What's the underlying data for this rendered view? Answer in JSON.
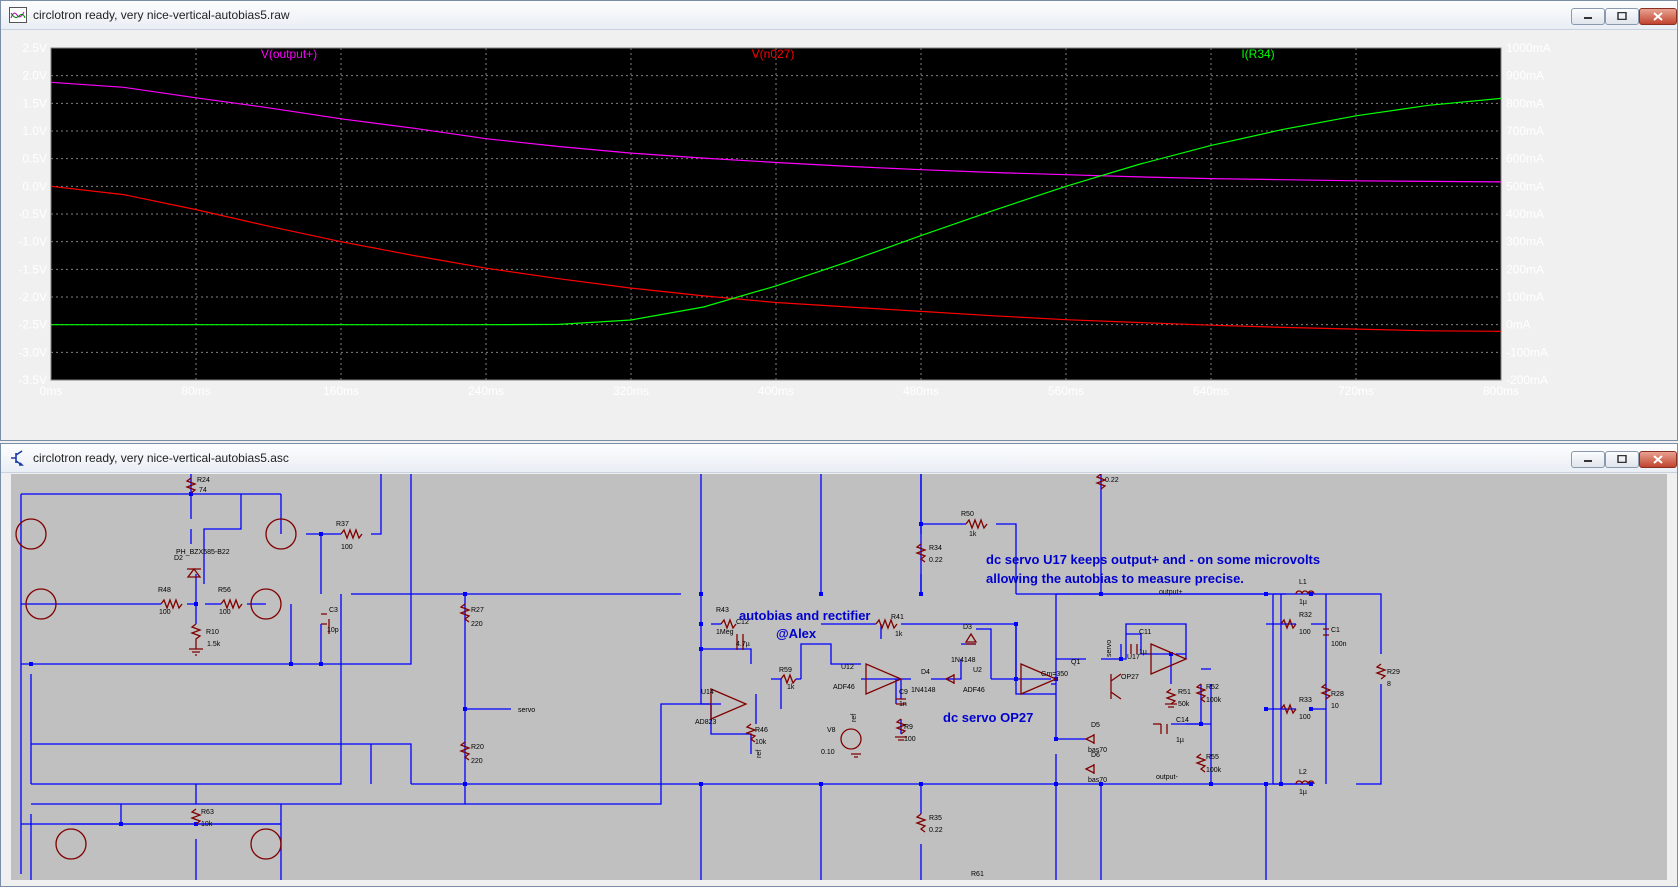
{
  "waveform_window": {
    "title": "circlotron ready, very nice-vertical-autobias5.raw",
    "icon": "waveform-icon",
    "buttons": {
      "minimize": "minimize-icon",
      "maximize": "maximize-icon",
      "close": "close-icon"
    }
  },
  "schematic_window": {
    "title": "circlotron ready, very nice-vertical-autobias5.asc",
    "icon": "schematic-icon",
    "buttons": {
      "minimize": "minimize-icon",
      "maximize": "maximize-icon",
      "close": "close-icon"
    }
  },
  "colors": {
    "plot_bg": "#000000",
    "axis_text": "#ffffff",
    "grid": "#808080",
    "schematic_bg": "#c0c0c0",
    "wire": "#0000ff",
    "component": "#800000",
    "annotation": "#0000cc"
  },
  "chart_data": {
    "type": "line",
    "x": [
      0,
      40,
      80,
      120,
      160,
      200,
      240,
      280,
      320,
      360,
      400,
      440,
      480,
      520,
      560,
      600,
      640,
      680,
      720,
      760,
      800
    ],
    "x_ticks": [
      "0ms",
      "80ms",
      "160ms",
      "240ms",
      "320ms",
      "400ms",
      "480ms",
      "560ms",
      "640ms",
      "720ms",
      "800ms"
    ],
    "xlim": [
      0,
      800
    ],
    "left_axis": {
      "ylim": [
        -3.5,
        2.5
      ],
      "ticks": [
        "2.5V",
        "2.0V",
        "1.5V",
        "1.0V",
        "0.5V",
        "0.0V",
        "-0.5V",
        "-1.0V",
        "-1.5V",
        "-2.0V",
        "-2.5V",
        "-3.0V",
        "-3.5V"
      ]
    },
    "right_axis": {
      "ylim": [
        -200,
        1000
      ],
      "ticks": [
        "1000mA",
        "900mA",
        "800mA",
        "700mA",
        "600mA",
        "500mA",
        "400mA",
        "300mA",
        "200mA",
        "100mA",
        "0mA",
        "-100mA",
        "-200mA"
      ]
    },
    "grid": true,
    "series": [
      {
        "name": "V(output+)",
        "color": "#ff00ff",
        "axis": "left",
        "values": [
          1.88,
          1.79,
          1.6,
          1.42,
          1.22,
          1.05,
          0.86,
          0.72,
          0.6,
          0.51,
          0.43,
          0.36,
          0.3,
          0.25,
          0.21,
          0.17,
          0.14,
          0.12,
          0.1,
          0.09,
          0.08
        ]
      },
      {
        "name": "V(n027)",
        "color": "#ff0000",
        "axis": "left",
        "values": [
          0.0,
          -0.15,
          -0.42,
          -0.72,
          -1.0,
          -1.25,
          -1.48,
          -1.67,
          -1.84,
          -1.98,
          -2.1,
          -2.18,
          -2.26,
          -2.34,
          -2.41,
          -2.46,
          -2.51,
          -2.55,
          -2.58,
          -2.61,
          -2.62
        ]
      },
      {
        "name": "I(R34)",
        "color": "#00ff00",
        "axis": "right",
        "values": [
          0,
          0,
          0,
          0,
          0,
          0,
          0,
          1,
          17,
          64,
          140,
          228,
          322,
          413,
          500,
          579,
          648,
          706,
          755,
          793,
          818
        ]
      }
    ]
  },
  "schematic": {
    "annotations": [
      "dc servo U17 keeps output+ and - on some microvolts",
      "allowing the autobias to measure precise.",
      "autobias and rectifier",
      "@Alex",
      "dc servo OP27"
    ],
    "net_labels": [
      "output+",
      "output-",
      "servo",
      "ref",
      "ref"
    ],
    "components": [
      {
        "ref": "R24",
        "value": "74"
      },
      {
        "ref": "R37",
        "value": "100"
      },
      {
        "ref": "D2",
        "value": "PH_BZX585-B22"
      },
      {
        "ref": "R48",
        "value": "100"
      },
      {
        "ref": "R56",
        "value": "100"
      },
      {
        "ref": "R10",
        "value": "1.5k"
      },
      {
        "ref": "C3",
        "value": "10p"
      },
      {
        "ref": "R27",
        "value": "220"
      },
      {
        "ref": "R20",
        "value": "220"
      },
      {
        "ref": "R63",
        "value": "10k"
      },
      {
        "ref": "R43",
        "value": "1Meg"
      },
      {
        "ref": "C12",
        "value": "4.7µ"
      },
      {
        "ref": "U14",
        "value": "AD823"
      },
      {
        "ref": "R46",
        "value": "10k"
      },
      {
        "ref": "R59",
        "value": "1k"
      },
      {
        "ref": "U12",
        "value": "ADF46"
      },
      {
        "ref": "R41",
        "value": "1k"
      },
      {
        "ref": "D3",
        "value": "1N4148"
      },
      {
        "ref": "D4",
        "value": "1N4148"
      },
      {
        "ref": "U2",
        "value": "ADF46"
      },
      {
        "ref": "C9",
        "value": "1n"
      },
      {
        "ref": "R9",
        "value": "100"
      },
      {
        "ref": "V8",
        "value": "0.10"
      },
      {
        "ref": "R34",
        "value": "0.22"
      },
      {
        "ref": "R50",
        "value": "1k"
      },
      {
        "ref": "R35",
        "value": "0.22"
      },
      {
        "ref": "R61",
        "value": ""
      },
      {
        "ref": "Q1",
        "value": "Gm=350"
      },
      {
        "ref": "C11",
        "value": "1µ"
      },
      {
        "ref": "U17",
        "value": "OP27"
      },
      {
        "ref": "R51",
        "value": "50k"
      },
      {
        "ref": "R52",
        "value": "100k"
      },
      {
        "ref": "C14",
        "value": "1µ"
      },
      {
        "ref": "R55",
        "value": "100k"
      },
      {
        "ref": "D5",
        "value": "bas70"
      },
      {
        "ref": "D6",
        "value": "bas70"
      },
      {
        "ref": "L1",
        "value": "1µ"
      },
      {
        "ref": "R32",
        "value": "100"
      },
      {
        "ref": "C1",
        "value": "100n"
      },
      {
        "ref": "R28",
        "value": "10"
      },
      {
        "ref": "R33",
        "value": "100"
      },
      {
        "ref": "L2",
        "value": "1µ"
      },
      {
        "ref": "R29",
        "value": "8"
      }
    ]
  }
}
